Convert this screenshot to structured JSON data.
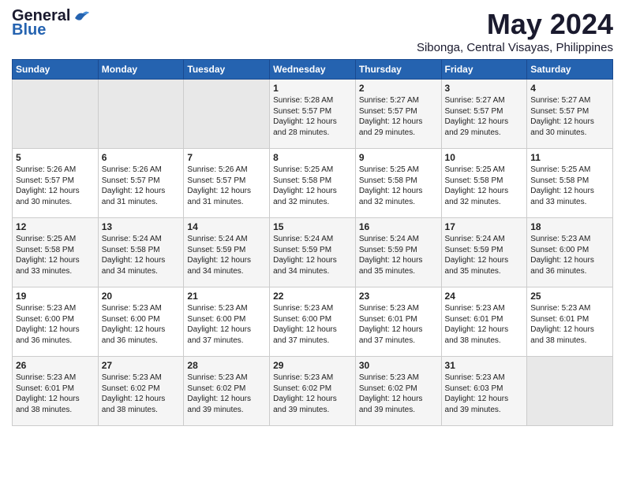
{
  "logo": {
    "general": "General",
    "blue": "Blue"
  },
  "title": "May 2024",
  "subtitle": "Sibonga, Central Visayas, Philippines",
  "weekdays": [
    "Sunday",
    "Monday",
    "Tuesday",
    "Wednesday",
    "Thursday",
    "Friday",
    "Saturday"
  ],
  "weeks": [
    [
      {
        "day": "",
        "sunrise": "",
        "sunset": "",
        "daylight": ""
      },
      {
        "day": "",
        "sunrise": "",
        "sunset": "",
        "daylight": ""
      },
      {
        "day": "",
        "sunrise": "",
        "sunset": "",
        "daylight": ""
      },
      {
        "day": "1",
        "sunrise": "Sunrise: 5:28 AM",
        "sunset": "Sunset: 5:57 PM",
        "daylight": "Daylight: 12 hours and 28 minutes."
      },
      {
        "day": "2",
        "sunrise": "Sunrise: 5:27 AM",
        "sunset": "Sunset: 5:57 PM",
        "daylight": "Daylight: 12 hours and 29 minutes."
      },
      {
        "day": "3",
        "sunrise": "Sunrise: 5:27 AM",
        "sunset": "Sunset: 5:57 PM",
        "daylight": "Daylight: 12 hours and 29 minutes."
      },
      {
        "day": "4",
        "sunrise": "Sunrise: 5:27 AM",
        "sunset": "Sunset: 5:57 PM",
        "daylight": "Daylight: 12 hours and 30 minutes."
      }
    ],
    [
      {
        "day": "5",
        "sunrise": "Sunrise: 5:26 AM",
        "sunset": "Sunset: 5:57 PM",
        "daylight": "Daylight: 12 hours and 30 minutes."
      },
      {
        "day": "6",
        "sunrise": "Sunrise: 5:26 AM",
        "sunset": "Sunset: 5:57 PM",
        "daylight": "Daylight: 12 hours and 31 minutes."
      },
      {
        "day": "7",
        "sunrise": "Sunrise: 5:26 AM",
        "sunset": "Sunset: 5:57 PM",
        "daylight": "Daylight: 12 hours and 31 minutes."
      },
      {
        "day": "8",
        "sunrise": "Sunrise: 5:25 AM",
        "sunset": "Sunset: 5:58 PM",
        "daylight": "Daylight: 12 hours and 32 minutes."
      },
      {
        "day": "9",
        "sunrise": "Sunrise: 5:25 AM",
        "sunset": "Sunset: 5:58 PM",
        "daylight": "Daylight: 12 hours and 32 minutes."
      },
      {
        "day": "10",
        "sunrise": "Sunrise: 5:25 AM",
        "sunset": "Sunset: 5:58 PM",
        "daylight": "Daylight: 12 hours and 32 minutes."
      },
      {
        "day": "11",
        "sunrise": "Sunrise: 5:25 AM",
        "sunset": "Sunset: 5:58 PM",
        "daylight": "Daylight: 12 hours and 33 minutes."
      }
    ],
    [
      {
        "day": "12",
        "sunrise": "Sunrise: 5:25 AM",
        "sunset": "Sunset: 5:58 PM",
        "daylight": "Daylight: 12 hours and 33 minutes."
      },
      {
        "day": "13",
        "sunrise": "Sunrise: 5:24 AM",
        "sunset": "Sunset: 5:58 PM",
        "daylight": "Daylight: 12 hours and 34 minutes."
      },
      {
        "day": "14",
        "sunrise": "Sunrise: 5:24 AM",
        "sunset": "Sunset: 5:59 PM",
        "daylight": "Daylight: 12 hours and 34 minutes."
      },
      {
        "day": "15",
        "sunrise": "Sunrise: 5:24 AM",
        "sunset": "Sunset: 5:59 PM",
        "daylight": "Daylight: 12 hours and 34 minutes."
      },
      {
        "day": "16",
        "sunrise": "Sunrise: 5:24 AM",
        "sunset": "Sunset: 5:59 PM",
        "daylight": "Daylight: 12 hours and 35 minutes."
      },
      {
        "day": "17",
        "sunrise": "Sunrise: 5:24 AM",
        "sunset": "Sunset: 5:59 PM",
        "daylight": "Daylight: 12 hours and 35 minutes."
      },
      {
        "day": "18",
        "sunrise": "Sunrise: 5:23 AM",
        "sunset": "Sunset: 6:00 PM",
        "daylight": "Daylight: 12 hours and 36 minutes."
      }
    ],
    [
      {
        "day": "19",
        "sunrise": "Sunrise: 5:23 AM",
        "sunset": "Sunset: 6:00 PM",
        "daylight": "Daylight: 12 hours and 36 minutes."
      },
      {
        "day": "20",
        "sunrise": "Sunrise: 5:23 AM",
        "sunset": "Sunset: 6:00 PM",
        "daylight": "Daylight: 12 hours and 36 minutes."
      },
      {
        "day": "21",
        "sunrise": "Sunrise: 5:23 AM",
        "sunset": "Sunset: 6:00 PM",
        "daylight": "Daylight: 12 hours and 37 minutes."
      },
      {
        "day": "22",
        "sunrise": "Sunrise: 5:23 AM",
        "sunset": "Sunset: 6:00 PM",
        "daylight": "Daylight: 12 hours and 37 minutes."
      },
      {
        "day": "23",
        "sunrise": "Sunrise: 5:23 AM",
        "sunset": "Sunset: 6:01 PM",
        "daylight": "Daylight: 12 hours and 37 minutes."
      },
      {
        "day": "24",
        "sunrise": "Sunrise: 5:23 AM",
        "sunset": "Sunset: 6:01 PM",
        "daylight": "Daylight: 12 hours and 38 minutes."
      },
      {
        "day": "25",
        "sunrise": "Sunrise: 5:23 AM",
        "sunset": "Sunset: 6:01 PM",
        "daylight": "Daylight: 12 hours and 38 minutes."
      }
    ],
    [
      {
        "day": "26",
        "sunrise": "Sunrise: 5:23 AM",
        "sunset": "Sunset: 6:01 PM",
        "daylight": "Daylight: 12 hours and 38 minutes."
      },
      {
        "day": "27",
        "sunrise": "Sunrise: 5:23 AM",
        "sunset": "Sunset: 6:02 PM",
        "daylight": "Daylight: 12 hours and 38 minutes."
      },
      {
        "day": "28",
        "sunrise": "Sunrise: 5:23 AM",
        "sunset": "Sunset: 6:02 PM",
        "daylight": "Daylight: 12 hours and 39 minutes."
      },
      {
        "day": "29",
        "sunrise": "Sunrise: 5:23 AM",
        "sunset": "Sunset: 6:02 PM",
        "daylight": "Daylight: 12 hours and 39 minutes."
      },
      {
        "day": "30",
        "sunrise": "Sunrise: 5:23 AM",
        "sunset": "Sunset: 6:02 PM",
        "daylight": "Daylight: 12 hours and 39 minutes."
      },
      {
        "day": "31",
        "sunrise": "Sunrise: 5:23 AM",
        "sunset": "Sunset: 6:03 PM",
        "daylight": "Daylight: 12 hours and 39 minutes."
      },
      {
        "day": "",
        "sunrise": "",
        "sunset": "",
        "daylight": ""
      }
    ]
  ]
}
